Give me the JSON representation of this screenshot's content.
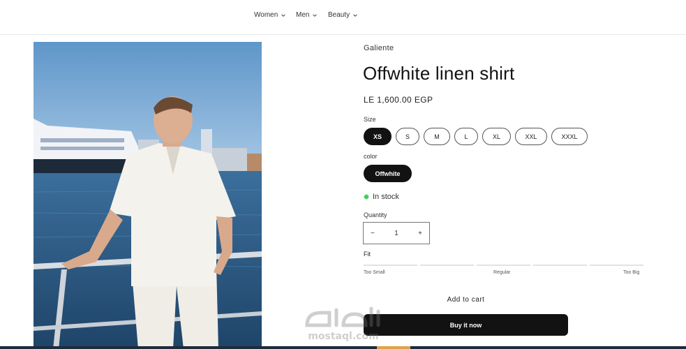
{
  "nav": {
    "items": [
      {
        "label": "Women"
      },
      {
        "label": "Men"
      },
      {
        "label": "Beauty"
      }
    ]
  },
  "product": {
    "vendor": "Galiente",
    "title": "Offwhite linen shirt",
    "price": "LE 1,600.00 EGP",
    "size_label": "Size",
    "sizes": [
      "XS",
      "S",
      "M",
      "L",
      "XL",
      "XXL",
      "XXXL"
    ],
    "selected_size": "XS",
    "color_label": "color",
    "color_value": "Offwhite",
    "stock_text": "In stock",
    "quantity_label": "Quantity",
    "quantity_value": "1",
    "quantity_minus": "−",
    "quantity_plus": "+",
    "fit_label": "Fit",
    "fit_scale": [
      "Too Small",
      "Regular",
      "Too Big"
    ],
    "add_to_cart": "Add to cart",
    "buy_now": "Buy it now"
  },
  "watermark": {
    "text": "mostaql.com"
  },
  "colors": {
    "accent": "#121212",
    "stock": "#3ecf5a",
    "sky": "#6aa1cf",
    "water": "#2d5a85"
  },
  "icons": {
    "nav_chevron": "chevron-down-icon",
    "stock_indicator": "status-dot-icon"
  }
}
